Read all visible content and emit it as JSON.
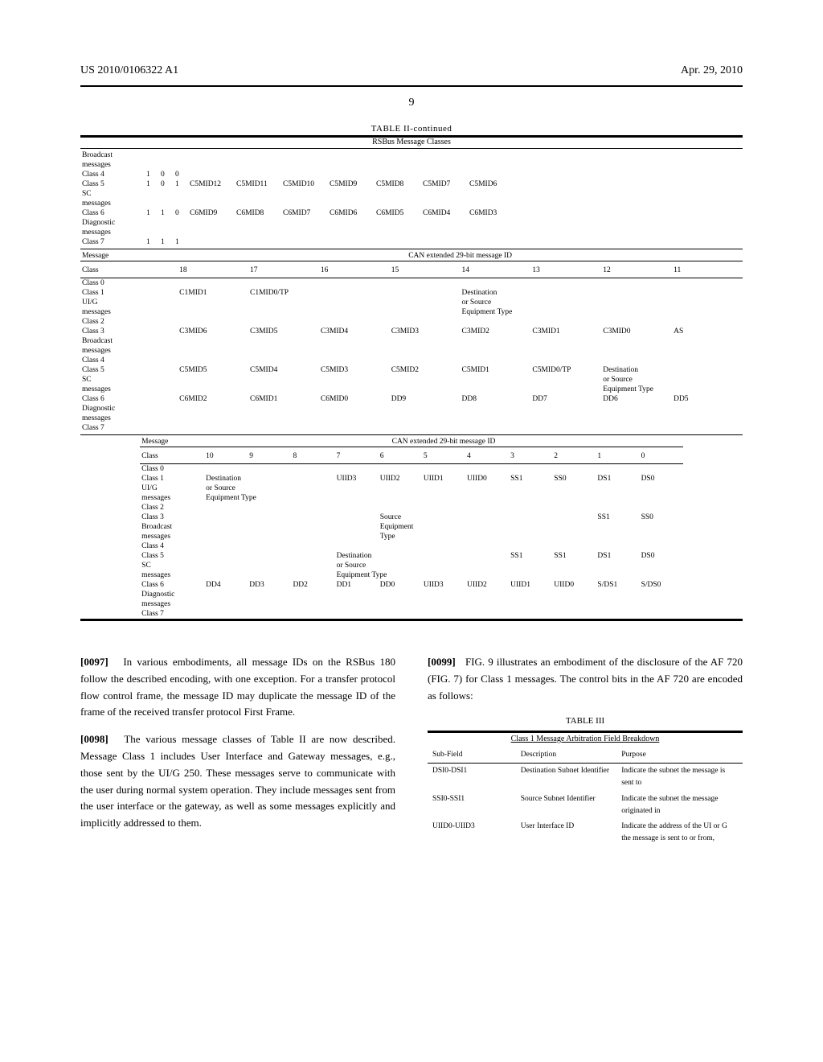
{
  "header": {
    "pub_number": "US 2010/0106322 A1",
    "pub_date": "Apr. 29, 2010",
    "page_number": "9"
  },
  "table2": {
    "title": "TABLE II-continued",
    "subtitle": "RSBus Message Classes",
    "can_label": "CAN extended 29-bit message ID",
    "section1": {
      "bits28_19_rows": [
        {
          "class": "Broadcast",
          "b": [
            "",
            "",
            ""
          ],
          "cells": [
            "",
            "",
            "",
            "",
            "",
            "",
            "",
            ""
          ]
        },
        {
          "class": "messages",
          "b": [
            "",
            "",
            ""
          ],
          "cells": [
            "",
            "",
            "",
            "",
            "",
            "",
            "",
            ""
          ]
        },
        {
          "class": "Class 4",
          "b": [
            "1",
            "0",
            "0"
          ],
          "cells": [
            "",
            "",
            "",
            "",
            "",
            "",
            "",
            ""
          ]
        },
        {
          "class": "Class 5",
          "b": [
            "1",
            "0",
            "1"
          ],
          "cells": [
            "C5MID12",
            "C5MID11",
            "C5MID10",
            "C5MID9",
            "C5MID8",
            "C5MID7",
            "C5MID6",
            ""
          ]
        },
        {
          "class": "SC",
          "b": [
            "",
            "",
            ""
          ],
          "cells": [
            "",
            "",
            "",
            "",
            "",
            "",
            "",
            ""
          ]
        },
        {
          "class": "messages",
          "b": [
            "",
            "",
            ""
          ],
          "cells": [
            "",
            "",
            "",
            "",
            "",
            "",
            "",
            ""
          ]
        },
        {
          "class": "Class 6",
          "b": [
            "1",
            "1",
            "0"
          ],
          "cells": [
            "C6MID9",
            "C6MID8",
            "C6MID7",
            "C6MID6",
            "C6MID5",
            "C6MID4",
            "C6MID3",
            ""
          ]
        },
        {
          "class": "Diagnostic",
          "b": [
            "",
            "",
            ""
          ],
          "cells": [
            "",
            "",
            "",
            "",
            "",
            "",
            "",
            ""
          ]
        },
        {
          "class": "messages",
          "b": [
            "",
            "",
            ""
          ],
          "cells": [
            "",
            "",
            "",
            "",
            "",
            "",
            "",
            ""
          ]
        },
        {
          "class": "Class 7",
          "b": [
            "1",
            "1",
            "1"
          ],
          "cells": [
            "",
            "",
            "",
            "",
            "",
            "",
            "",
            ""
          ]
        }
      ]
    },
    "section2": {
      "msg_label": "Message",
      "class_label": "Class",
      "bits": [
        "18",
        "17",
        "16",
        "15",
        "14",
        "13",
        "12",
        "11"
      ],
      "rows": [
        {
          "class": "Class 0",
          "cells": [
            "",
            "",
            "",
            "",
            "",
            "",
            "",
            ""
          ]
        },
        {
          "class": "Class 1",
          "cells": [
            "C1MID1",
            "C1MID0/TP",
            "",
            "",
            "Destination",
            "",
            "",
            ""
          ]
        },
        {
          "class": "UI/G",
          "cells": [
            "",
            "",
            "",
            "",
            "or Source",
            "",
            "",
            ""
          ]
        },
        {
          "class": "messages",
          "cells": [
            "",
            "",
            "",
            "",
            "Equipment Type",
            "",
            "",
            ""
          ]
        },
        {
          "class": "Class 2",
          "cells": [
            "",
            "",
            "",
            "",
            "",
            "",
            "",
            ""
          ]
        },
        {
          "class": "Class 3",
          "cells": [
            "C3MID6",
            "C3MID5",
            "C3MID4",
            "C3MID3",
            "C3MID2",
            "C3MID1",
            "C3MID0",
            "AS"
          ]
        },
        {
          "class": "Broadcast",
          "cells": [
            "",
            "",
            "",
            "",
            "",
            "",
            "",
            ""
          ]
        },
        {
          "class": "messages",
          "cells": [
            "",
            "",
            "",
            "",
            "",
            "",
            "",
            ""
          ]
        },
        {
          "class": "Class 4",
          "cells": [
            "",
            "",
            "",
            "",
            "",
            "",
            "",
            ""
          ]
        },
        {
          "class": "Class 5",
          "cells": [
            "C5MID5",
            "C5MID4",
            "C5MID3",
            "C5MID2",
            "C5MID1",
            "C5MID0/TP",
            "Destination",
            ""
          ]
        },
        {
          "class": "SC",
          "cells": [
            "",
            "",
            "",
            "",
            "",
            "",
            "or Source",
            ""
          ]
        },
        {
          "class": "messages",
          "cells": [
            "",
            "",
            "",
            "",
            "",
            "",
            "Equipment Type",
            ""
          ]
        },
        {
          "class": "Class 6",
          "cells": [
            "C6MID2",
            "C6MID1",
            "C6MID0",
            "DD9",
            "DD8",
            "DD7",
            "DD6",
            "DD5"
          ]
        },
        {
          "class": "Diagnostic",
          "cells": [
            "",
            "",
            "",
            "",
            "",
            "",
            "",
            ""
          ]
        },
        {
          "class": "messages",
          "cells": [
            "",
            "",
            "",
            "",
            "",
            "",
            "",
            ""
          ]
        },
        {
          "class": "Class 7",
          "cells": [
            "",
            "",
            "",
            "",
            "",
            "",
            "",
            ""
          ]
        }
      ]
    },
    "section3": {
      "msg_label": "Message",
      "class_label": "Class",
      "bits": [
        "10",
        "9",
        "8",
        "7",
        "6",
        "5",
        "4",
        "3",
        "2",
        "1",
        "0"
      ],
      "rows": [
        {
          "class": "Class 0",
          "cells": [
            "",
            "",
            "",
            "",
            "",
            "",
            "",
            "",
            "",
            "",
            ""
          ]
        },
        {
          "class": "Class 1",
          "cells": [
            "Destination",
            "",
            "",
            "UIID3",
            "UIID2",
            "UIID1",
            "UIID0",
            "SS1",
            "SS0",
            "DS1",
            "DS0"
          ]
        },
        {
          "class": "UI/G",
          "cells": [
            "or Source",
            "",
            "",
            "",
            "",
            "",
            "",
            "",
            "",
            "",
            ""
          ]
        },
        {
          "class": "messages",
          "cells": [
            "Equipment Type",
            "",
            "",
            "",
            "",
            "",
            "",
            "",
            "",
            "",
            ""
          ]
        },
        {
          "class": "Class 2",
          "cells": [
            "",
            "",
            "",
            "",
            "",
            "",
            "",
            "",
            "",
            "",
            ""
          ]
        },
        {
          "class": "Class 3",
          "cells": [
            "",
            "",
            "",
            "",
            "Source",
            "",
            "",
            "",
            "",
            "SS1",
            "SS0"
          ]
        },
        {
          "class": "Broadcast",
          "cells": [
            "",
            "",
            "",
            "",
            "Equipment",
            "",
            "",
            "",
            "",
            "",
            ""
          ]
        },
        {
          "class": "messages",
          "cells": [
            "",
            "",
            "",
            "",
            "Type",
            "",
            "",
            "",
            "",
            "",
            ""
          ]
        },
        {
          "class": "Class 4",
          "cells": [
            "",
            "",
            "",
            "",
            "",
            "",
            "",
            "",
            "",
            "",
            ""
          ]
        },
        {
          "class": "Class 5",
          "cells": [
            "",
            "",
            "",
            "Destination",
            "",
            "",
            "",
            "SS1",
            "SS1",
            "DS1",
            "DS0"
          ]
        },
        {
          "class": "SC",
          "cells": [
            "",
            "",
            "",
            "or Source",
            "",
            "",
            "",
            "",
            "",
            "",
            ""
          ]
        },
        {
          "class": "messages",
          "cells": [
            "",
            "",
            "",
            "Equipment Type",
            "",
            "",
            "",
            "",
            "",
            "",
            ""
          ]
        },
        {
          "class": "Class 6",
          "cells": [
            "DD4",
            "DD3",
            "DD2",
            "DD1",
            "DD0",
            "UIID3",
            "UIID2",
            "UIID1",
            "UIID0",
            "S/DS1",
            "S/DS0"
          ]
        },
        {
          "class": "Diagnostic",
          "cells": [
            "",
            "",
            "",
            "",
            "",
            "",
            "",
            "",
            "",
            "",
            ""
          ]
        },
        {
          "class": "messages",
          "cells": [
            "",
            "",
            "",
            "",
            "",
            "",
            "",
            "",
            "",
            "",
            ""
          ]
        },
        {
          "class": "Class 7",
          "cells": [
            "",
            "",
            "",
            "",
            "",
            "",
            "",
            "",
            "",
            "",
            ""
          ]
        }
      ]
    }
  },
  "body": {
    "para1_num": "[0097]",
    "para1": "In various embodiments, all message IDs on the RSBus 180 follow the described encoding, with one exception. For a transfer protocol flow control frame, the message ID may duplicate the message ID of the frame of the received transfer protocol First Frame.",
    "para2_num": "[0098]",
    "para2": "The various message classes of Table II are now described. Message Class 1 includes User Interface and Gateway messages, e.g., those sent by the UI/G 250. These messages serve to communicate with the user during normal system operation. They include messages sent from the user interface or the gateway, as well as some messages explicitly and implicitly addressed to them.",
    "para3_num": "[0099]",
    "para3": "FIG. 9 illustrates an embodiment of the disclosure of the AF 720 (FIG. 7) for Class 1 messages. The control bits in the AF 720 are encoded as follows:"
  },
  "table3": {
    "title": "TABLE III",
    "subtitle": "Class 1 Message Arbitration Field Breakdown",
    "headers": [
      "Sub-Field",
      "Description",
      "Purpose"
    ],
    "rows": [
      {
        "sub": "DSI0-DSI1",
        "desc": "Destination Subnet Identifier",
        "purpose": "Indicate the subnet the message is sent to"
      },
      {
        "sub": "SSI0-SSI1",
        "desc": "Source Subnet Identifier",
        "purpose": "Indicate the subnet the message originated in"
      },
      {
        "sub": "UIID0-UIID3",
        "desc": "User Interface ID",
        "purpose": "Indicate the address of the UI or G the message is sent to or from,"
      }
    ]
  }
}
